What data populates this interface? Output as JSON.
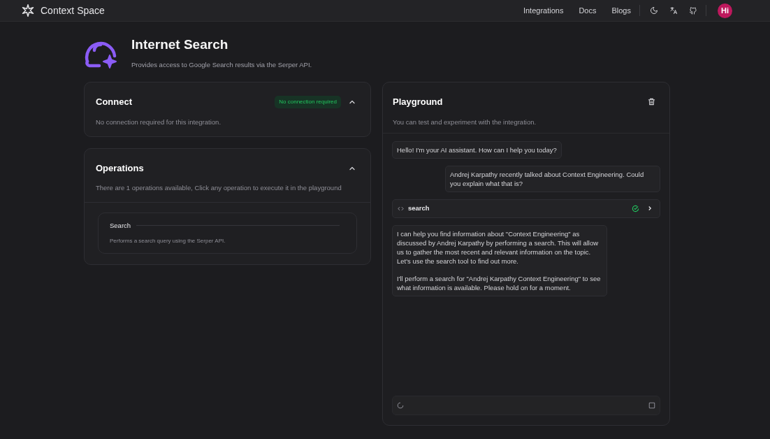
{
  "header": {
    "brand": "Context Space",
    "nav": [
      "Integrations",
      "Docs",
      "Blogs"
    ],
    "avatar": "Hi"
  },
  "integration": {
    "title": "Internet Search",
    "description": "Provides access to Google Search results via the Serper API."
  },
  "connect": {
    "title": "Connect",
    "badge": "No connection required",
    "expanded": true,
    "text": "No connection required for this integration."
  },
  "operations": {
    "title": "Operations",
    "expanded": true,
    "text": "There are 1 operations available, Click any operation to execute it in the playground",
    "items": [
      {
        "name": "Search",
        "description": "Performs a search query using the Serper API."
      }
    ]
  },
  "playground": {
    "title": "Playground",
    "subtitle": "You can test and experiment with the integration.",
    "messages": [
      {
        "kind": "assistant",
        "paragraphs": [
          "Hello! I'm your AI assistant. How can I help you today?"
        ]
      },
      {
        "kind": "user",
        "paragraphs": [
          "Andrej Karpathy recently talked about Context Engineering. Could you explain what that is?"
        ]
      },
      {
        "kind": "tool",
        "name": "search",
        "done": true
      },
      {
        "kind": "assistant",
        "paragraphs": [
          "I can help you find information about \"Context Engineering\" as discussed by Andrej Karpathy by performing a search. This will allow us to gather the most recent and relevant information on the topic. Let's use the search tool to find out more.",
          "I'll perform a search for \"Andrej Karpathy Context Engineering\" to see what information is available. Please hold on for a moment."
        ]
      }
    ],
    "input": {
      "loading": true
    }
  }
}
